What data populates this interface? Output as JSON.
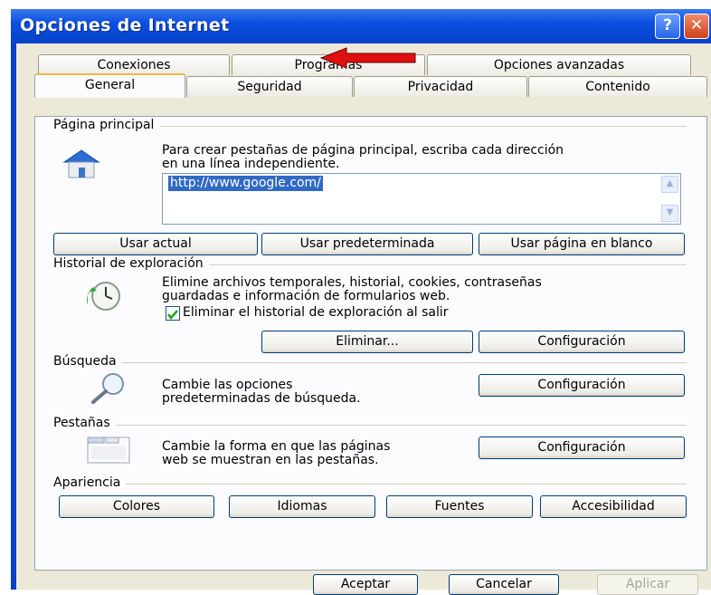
{
  "window": {
    "title": "Opciones de Internet",
    "help_glyph": "?",
    "close_glyph": "✕"
  },
  "tabs": {
    "row_back": [
      "Conexiones",
      "Programas",
      "Opciones avanzadas"
    ],
    "row_front": [
      "General",
      "Seguridad",
      "Privacidad",
      "Contenido"
    ],
    "active": "General"
  },
  "home_page": {
    "section_title": "Página principal",
    "description_line1": "Para crear pestañas de página principal, escriba cada dirección",
    "description_line2": "en una línea independiente.",
    "url": "http://www.google.com/",
    "buttons": {
      "use_current": "Usar actual",
      "use_default": "Usar predeterminada",
      "use_blank": "Usar página en blanco"
    }
  },
  "history": {
    "section_title": "Historial de exploración",
    "description_line1": "Elimine archivos temporales, historial, cookies, contraseñas",
    "description_line2": "guardadas e información de formularios web.",
    "checkbox_label": "Eliminar el historial de exploración al salir",
    "checkbox_checked": true,
    "delete_button": "Eliminar...",
    "settings_button": "Configuración"
  },
  "search": {
    "section_title": "Búsqueda",
    "description_line1": "Cambie las opciones",
    "description_line2": "predeterminadas de búsqueda.",
    "settings_button": "Configuración"
  },
  "tabs_section": {
    "section_title": "Pestañas",
    "description_line1": "Cambie la forma en que las páginas",
    "description_line2": "web se muestran en las pestañas.",
    "settings_button": "Configuración"
  },
  "appearance": {
    "section_title": "Apariencia",
    "buttons": {
      "colors": "Colores",
      "languages": "Idiomas",
      "fonts": "Fuentes",
      "accessibility": "Accesibilidad"
    }
  },
  "footer": {
    "ok": "Aceptar",
    "cancel": "Cancelar",
    "apply": "Aplicar"
  },
  "colors": {
    "titlebar": "#0642c8",
    "dialog": "#ece9d8",
    "arrow": "#e01010"
  },
  "icons": [
    "house-icon",
    "history-clock-icon",
    "magnifier-icon",
    "tabs-window-icon",
    "red-arrow-icon"
  ]
}
